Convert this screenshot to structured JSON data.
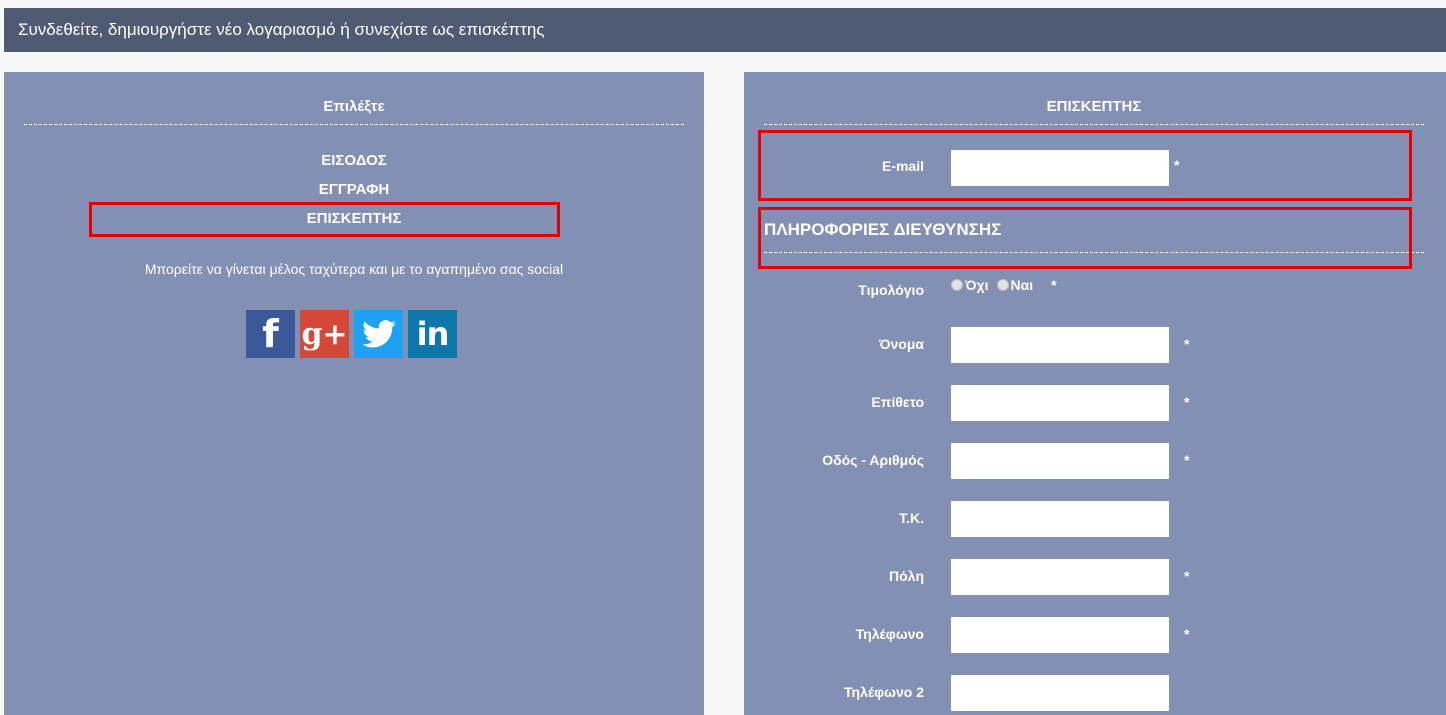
{
  "header": {
    "title": "Συνδεθείτε, δημιουργήστε νέο λογαριασμό ή συνεχίστε ως επισκέπτης"
  },
  "left_panel": {
    "title": "Επιλέξτε",
    "options": [
      {
        "label": "ΕΙΣΟΔΟΣ"
      },
      {
        "label": "ΕΓΓΡΑΦΗ"
      },
      {
        "label": "ΕΠΙΣΚΕΠΤΗΣ"
      }
    ],
    "social_text": "Μπορείτε να γίνεται μέλος ταχύτερα και με το αγαπημένο σας social",
    "social_icons": {
      "facebook": "f",
      "google": "g+",
      "twitter": "twitter-bird",
      "linkedin": "in"
    }
  },
  "right_panel": {
    "title": "ΕΠΙΣΚΕΠΤΗΣ",
    "email": {
      "label": "E-mail",
      "value": "",
      "required": "*"
    },
    "address_section_title": "ΠΛΗΡΟΦΟΡΙΕΣ ΔΙΕΥΘΥΝΣΗΣ",
    "invoice": {
      "label": "Τιμολόγιο",
      "options": [
        "Όχι",
        "Ναι"
      ],
      "required": "*"
    },
    "fields": [
      {
        "label": "Όνομα",
        "value": "",
        "required": "*"
      },
      {
        "label": "Επίθετο",
        "value": "",
        "required": "*"
      },
      {
        "label": "Οδός - Αριθμός",
        "value": "",
        "required": "*"
      },
      {
        "label": "Τ.Κ.",
        "value": "",
        "required": ""
      },
      {
        "label": "Πόλη",
        "value": "",
        "required": "*"
      },
      {
        "label": "Τηλέφωνο",
        "value": "",
        "required": "*"
      },
      {
        "label": "Τηλέφωνο 2",
        "value": "",
        "required": ""
      }
    ]
  },
  "colors": {
    "header_bg": "#4f5a73",
    "panel_bg": "#8390b4",
    "highlight": "#e10000",
    "facebook": "#3b5998",
    "google": "#d34836",
    "twitter": "#1da1f2",
    "linkedin": "#0e76a8"
  }
}
